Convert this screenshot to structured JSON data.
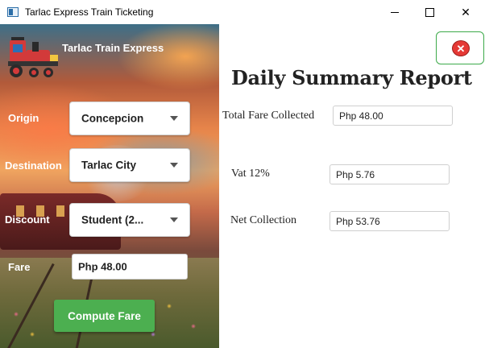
{
  "window": {
    "title": "Tarlac Express Train Ticketing",
    "controls": {
      "minimize": "—",
      "maximize": "☐",
      "close": "✕"
    }
  },
  "brand": {
    "name": "Tarlac Train Express",
    "logo_icon": "train-icon"
  },
  "form": {
    "origin": {
      "label": "Origin",
      "value": "Concepcion"
    },
    "destination": {
      "label": "Destination",
      "value": "Tarlac City"
    },
    "discount": {
      "label": "Discount",
      "value": "Student (2..."
    },
    "fare": {
      "label": "Fare",
      "value": "Php 48.00"
    },
    "compute_label": "Compute Fare"
  },
  "report": {
    "title": "Daily Summary Report",
    "close_icon": "close-circle-icon",
    "total_fare": {
      "label": "Total Fare Collected",
      "value": "Php 48.00"
    },
    "vat": {
      "label": "Vat 12%",
      "value": "Php 5.76"
    },
    "net": {
      "label": "Net Collection",
      "value": "Php 53.76"
    }
  },
  "colors": {
    "accent_green": "#4caf50",
    "close_red": "#e53935",
    "title_text": "#222222"
  }
}
